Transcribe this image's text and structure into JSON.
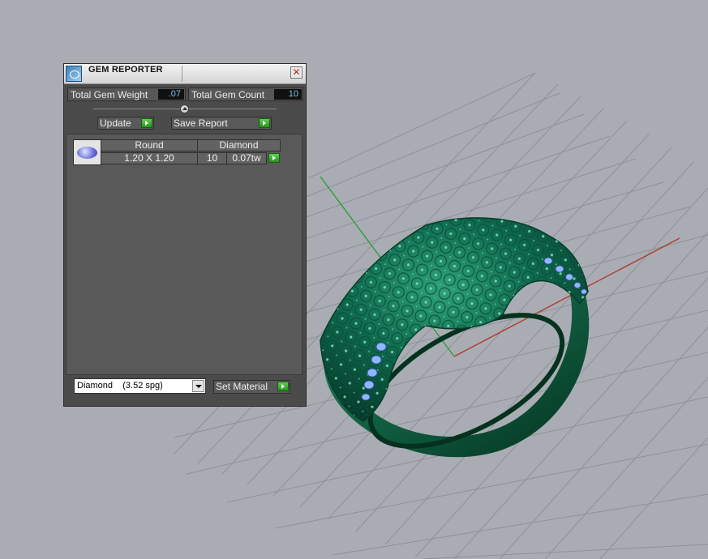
{
  "panel": {
    "title": "GEM REPORTER",
    "total_weight_label": "Total Gem Weight",
    "total_weight_value": ".07",
    "total_count_label": "Total Gem Count",
    "total_count_value": "10",
    "update_label": "Update",
    "save_report_label": "Save Report",
    "gems": [
      {
        "shape": "Round",
        "size": "1.20 X 1.20",
        "material": "Diamond",
        "count": "10",
        "weight": "0.07tw"
      }
    ],
    "material_select_value": "Diamond    (3.52 spg)",
    "set_material_label": "Set Material"
  },
  "colors": {
    "viewport_bg": "#a9adb3",
    "ring": "#0f6b4e",
    "gem_blue": "#8fb6ff",
    "axis_x": "#b03a2e",
    "axis_y": "#2e9a3e",
    "accent_green": "#3fbf2f"
  }
}
